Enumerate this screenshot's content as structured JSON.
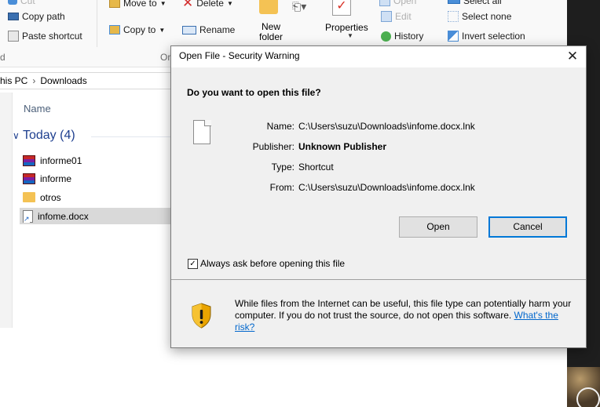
{
  "explorer": {
    "ribbon": {
      "cut": "Cut",
      "copy_path": "Copy path",
      "paste_shortcut": "Paste shortcut",
      "move_to": "Move to",
      "copy_to": "Copy to",
      "delete": "Delete",
      "rename": "Rename",
      "new_folder": "New folder",
      "properties": "Properties",
      "open": "Open",
      "edit": "Edit",
      "history": "History",
      "select_all": "Select all",
      "select_none": "Select none",
      "invert_selection": "Invert selection",
      "organize_group": "Orga",
      "clipboard_group_edge": "d"
    },
    "breadcrumb": [
      "his PC",
      "Downloads"
    ],
    "column_header": "Name",
    "group": {
      "label": "Today",
      "count": "(4)"
    },
    "files": [
      {
        "name": "informe01",
        "type": "rar"
      },
      {
        "name": "informe",
        "type": "rar"
      },
      {
        "name": "otros",
        "type": "folder"
      },
      {
        "name": "infome.docx",
        "type": "shortcut",
        "selected": true
      }
    ]
  },
  "dialog": {
    "title": "Open File - Security Warning",
    "close_glyph": "✕",
    "question": "Do you want to open this file?",
    "fields": [
      {
        "label": "Name:",
        "value": "C:\\Users\\suzu\\Downloads\\infome.docx.lnk",
        "bold": false
      },
      {
        "label": "Publisher:",
        "value": "Unknown Publisher",
        "bold": true
      },
      {
        "label": "Type:",
        "value": "Shortcut",
        "bold": false
      },
      {
        "label": "From:",
        "value": "C:\\Users\\suzu\\Downloads\\infome.docx.lnk",
        "bold": false
      }
    ],
    "open_button": "Open",
    "cancel_button": "Cancel",
    "always_ask_label": "Always ask before opening this file",
    "always_ask_checked": true,
    "warning_text": "While files from the Internet can be useful, this file type can potentially harm your computer. If you do not trust the source, do not open this software.",
    "risk_link": "What's the risk?"
  },
  "colors": {
    "dialog_bg": "#f0f0f0",
    "accent_blue": "#0078d7",
    "link_blue": "#0066cc",
    "group_header": "#1e3f8f",
    "delete_red": "#d32f2f",
    "selection_gray": "#d9d9d9"
  }
}
